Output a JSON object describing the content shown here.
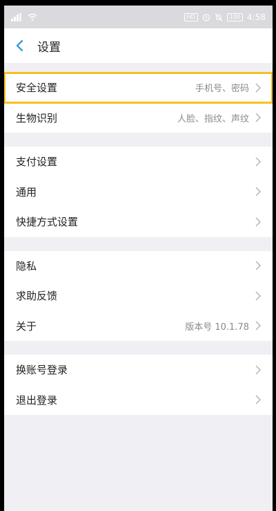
{
  "status_bar": {
    "signal_icon": "signal-icon",
    "wifi_icon": "wifi-icon",
    "hd_badge": "HD",
    "time": "4:58",
    "battery_text": "100"
  },
  "nav": {
    "title": "设置"
  },
  "groups": [
    {
      "items": [
        {
          "label": "安全设置",
          "value": "手机号、密码",
          "highlighted": true
        },
        {
          "label": "生物识别",
          "value": "人脸、指纹、声纹"
        }
      ]
    },
    {
      "items": [
        {
          "label": "支付设置",
          "value": ""
        },
        {
          "label": "通用",
          "value": ""
        },
        {
          "label": "快捷方式设置",
          "value": ""
        }
      ]
    },
    {
      "items": [
        {
          "label": "隐私",
          "value": ""
        },
        {
          "label": "求助反馈",
          "value": ""
        },
        {
          "label": "关于",
          "value": "版本号 10.1.78"
        }
      ]
    },
    {
      "items": [
        {
          "label": "换账号登录",
          "value": ""
        },
        {
          "label": "退出登录",
          "value": ""
        }
      ]
    }
  ],
  "colors": {
    "accent": "#1a8fd6",
    "highlight": "#f5c022",
    "background": "#efeff4"
  }
}
